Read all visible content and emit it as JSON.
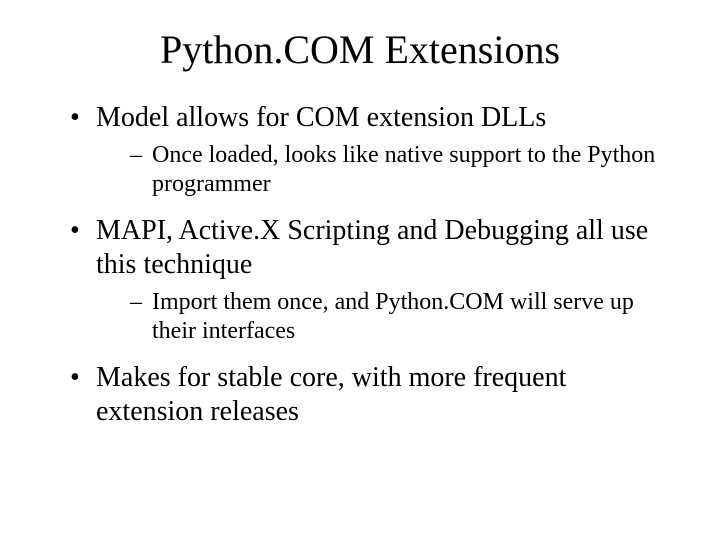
{
  "title": "Python.COM Extensions",
  "bullets": [
    {
      "text": "Model allows for COM extension DLLs",
      "sub": [
        "Once loaded, looks like native support to the Python programmer"
      ]
    },
    {
      "text": "MAPI, Active.X Scripting and Debugging all use this technique",
      "sub": [
        "Import them once, and Python.COM will serve up their interfaces"
      ]
    },
    {
      "text": "Makes for stable core, with more frequent extension releases",
      "sub": []
    }
  ]
}
